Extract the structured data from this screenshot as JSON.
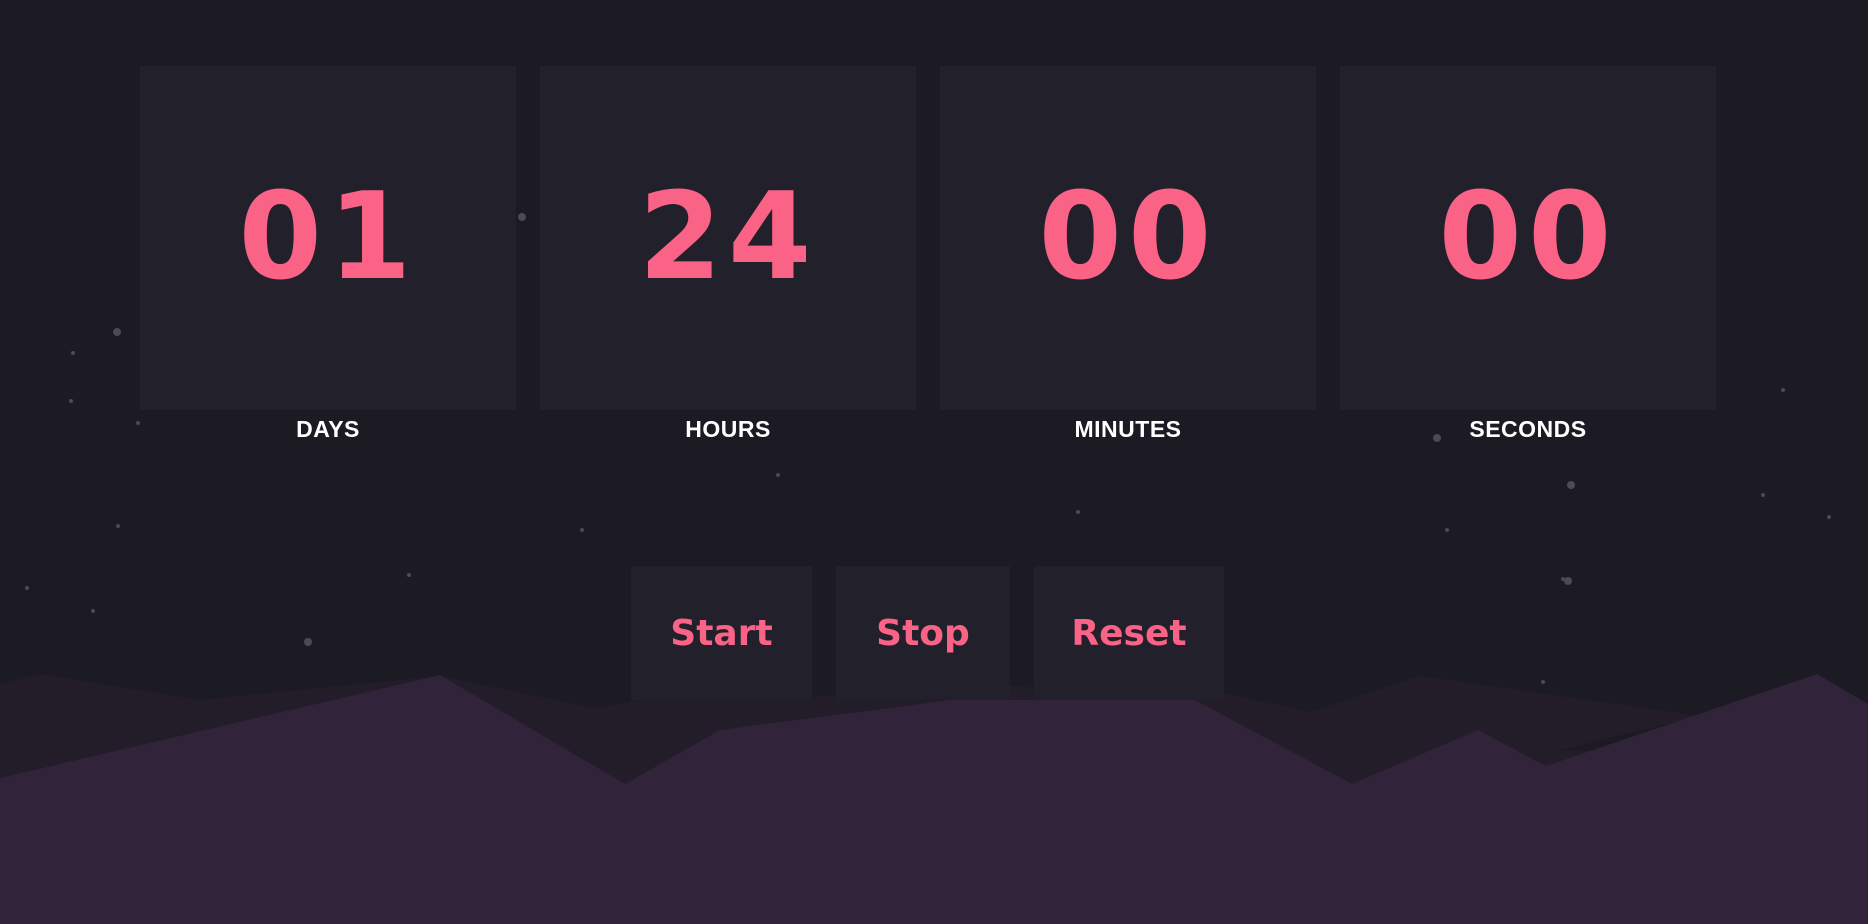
{
  "colors": {
    "background": "#1c1b24",
    "card": "#21202b",
    "accent": "#fb6386",
    "label": "#ffffff",
    "hill_front": "#30233a",
    "hill_back": "#231c29",
    "star": "#4a4a58"
  },
  "timer": {
    "units": [
      {
        "value": "01",
        "label": "DAYS"
      },
      {
        "value": "24",
        "label": "HOURS"
      },
      {
        "value": "00",
        "label": "MINUTES"
      },
      {
        "value": "00",
        "label": "SECONDS"
      }
    ]
  },
  "controls": {
    "start_label": "Start",
    "stop_label": "Stop",
    "reset_label": "Reset"
  }
}
